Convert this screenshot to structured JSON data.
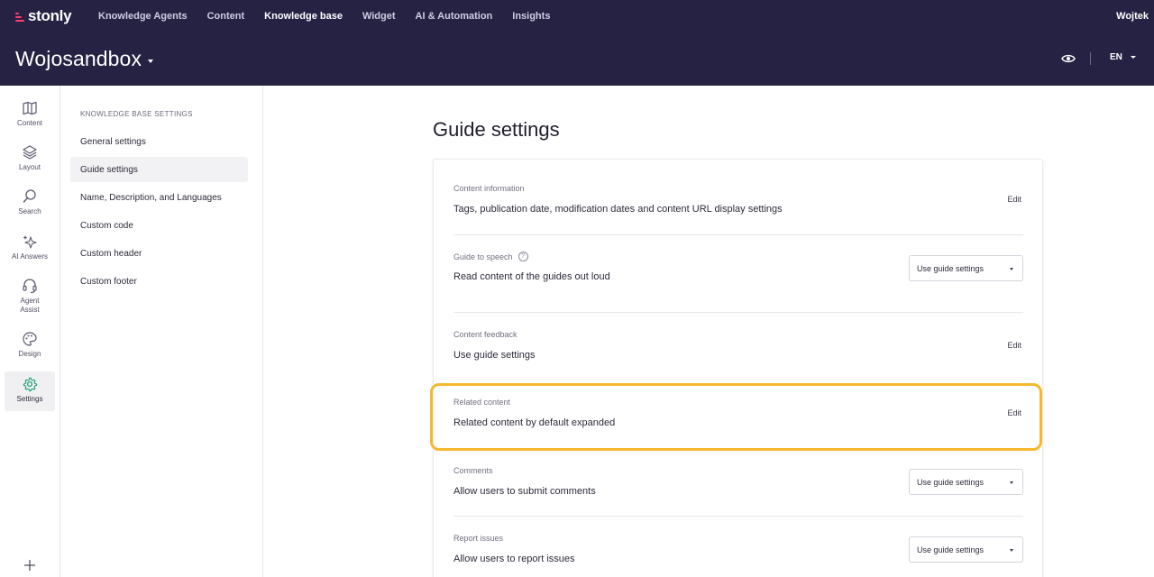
{
  "brand": {
    "name": "stonly",
    "accent_color": "#ff3d6e",
    "header_bg": "#262244"
  },
  "topnav": {
    "items": [
      {
        "label": "Knowledge Agents",
        "active": false
      },
      {
        "label": "Content",
        "active": false
      },
      {
        "label": "Knowledge base",
        "active": true
      },
      {
        "label": "Widget",
        "active": false
      },
      {
        "label": "AI & Automation",
        "active": false
      },
      {
        "label": "Insights",
        "active": false
      }
    ],
    "user_name": "Wojtek"
  },
  "subheader": {
    "workspace_name": "Wojosandbox",
    "preview_icon": "eye-icon",
    "language": "EN"
  },
  "rail": {
    "items": [
      {
        "label": "Content",
        "icon": "book-icon",
        "active": false
      },
      {
        "label": "Layout",
        "icon": "layers-icon",
        "active": false
      },
      {
        "label": "Search",
        "icon": "search-icon",
        "active": false
      },
      {
        "label": "AI Answers",
        "icon": "sparkle-icon",
        "active": false
      },
      {
        "label": "Agent Assist",
        "icon": "headset-icon",
        "active": false
      },
      {
        "label": "Design",
        "icon": "palette-icon",
        "active": false
      },
      {
        "label": "Settings",
        "icon": "gear-icon",
        "active": true,
        "color": "#1f9d6e"
      }
    ],
    "add_icon": "plus-icon"
  },
  "settings_nav": {
    "title": "KNOWLEDGE BASE SETTINGS",
    "items": [
      {
        "label": "General settings",
        "active": false
      },
      {
        "label": "Guide settings",
        "active": true
      },
      {
        "label": "Name, Description, and Languages",
        "active": false
      },
      {
        "label": "Custom code",
        "active": false
      },
      {
        "label": "Custom header",
        "active": false
      },
      {
        "label": "Custom footer",
        "active": false
      }
    ]
  },
  "main": {
    "title": "Guide settings",
    "highlight_color": "#f5b82e",
    "rows": [
      {
        "label": "Content information",
        "value": "Tags, publication date, modification dates and content URL display settings",
        "action": "Edit"
      },
      {
        "label": "Guide to speech",
        "help_icon": "question-icon",
        "value": "Read content of the guides out loud",
        "select": "Use guide settings"
      },
      {
        "label": "Content feedback",
        "value": "Use guide settings",
        "action": "Edit"
      },
      {
        "label": "Related content",
        "value": "Related content by default expanded",
        "action": "Edit",
        "highlighted": true
      },
      {
        "label": "Comments",
        "value": "Allow users to submit comments",
        "select": "Use guide settings"
      },
      {
        "label": "Report issues",
        "value": "Allow users to report issues",
        "select": "Use guide settings"
      }
    ]
  }
}
